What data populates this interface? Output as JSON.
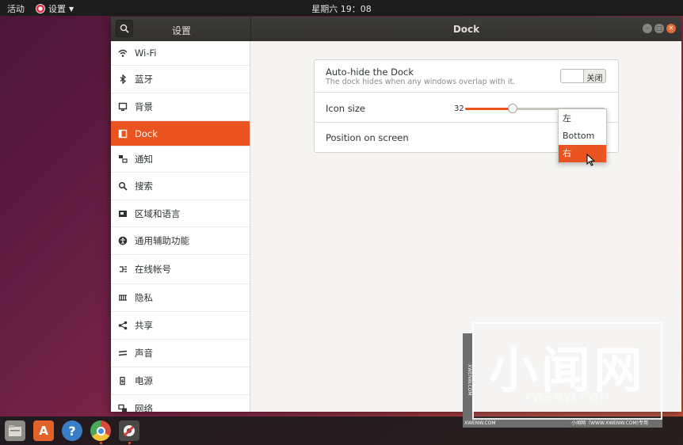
{
  "topbar": {
    "activities": "活动",
    "app_menu": "设置",
    "clock": "星期六 19：08"
  },
  "window": {
    "left_title": "设置",
    "title": "Dock"
  },
  "sidebar": {
    "items": [
      {
        "label": "Wi-Fi",
        "icon": "wifi-icon"
      },
      {
        "label": "蓝牙",
        "icon": "bluetooth-icon"
      },
      {
        "label": "背景",
        "icon": "background-icon"
      },
      {
        "label": "Dock",
        "icon": "dock-icon",
        "active": true
      },
      {
        "label": "通知",
        "icon": "notification-icon"
      },
      {
        "label": "搜索",
        "icon": "search-icon"
      },
      {
        "label": "区域和语言",
        "icon": "region-flag-icon"
      },
      {
        "label": "通用辅助功能",
        "icon": "accessibility-icon"
      },
      {
        "label": "在线帐号",
        "icon": "online-accounts-icon"
      },
      {
        "label": "隐私",
        "icon": "privacy-icon"
      },
      {
        "label": "共享",
        "icon": "share-icon"
      },
      {
        "label": "声音",
        "icon": "sound-icon"
      },
      {
        "label": "电源",
        "icon": "power-icon"
      },
      {
        "label": "网络",
        "icon": "network-icon"
      }
    ]
  },
  "dock_settings": {
    "autohide": {
      "title": "Auto-hide the Dock",
      "subtitle": "The dock hides when any windows overlap with it.",
      "switch_label": "关闭"
    },
    "icon_size": {
      "title": "Icon size",
      "value": "32",
      "fraction": 0.34
    },
    "position": {
      "title": "Position on screen",
      "options": [
        "左",
        "Bottom",
        "右"
      ],
      "selected": "右"
    }
  },
  "taskbar": {
    "apps": [
      "file-manager-icon",
      "software-store-icon",
      "help-icon",
      "chromium-icon",
      "settings-icon"
    ]
  },
  "watermark": {
    "big": "小闻网",
    "sub": "XWENW.COM",
    "side": "XWENW.COM",
    "bottom_left": "XWENW.COM",
    "bottom_right": "小闻网（WWW.XWENW.COM)专用"
  },
  "colors": {
    "accent": "#e95420",
    "titlebar": "#3a3935",
    "sidebar_bg": "#ffffff",
    "content_bg": "#f5f4f2"
  }
}
